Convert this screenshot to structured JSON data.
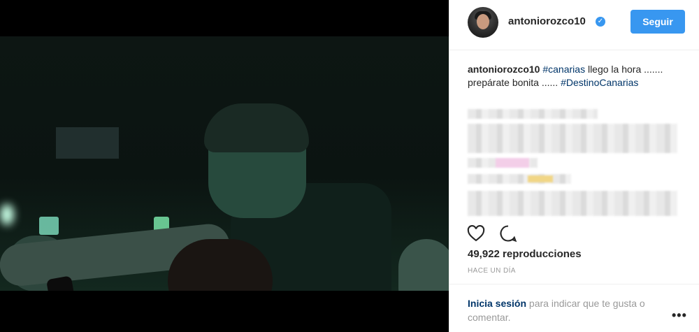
{
  "post": {
    "username": "antoniorozco10",
    "verified_icon": "verified-badge-icon",
    "follow_label": "Seguir",
    "caption": {
      "user": "antoniorozco10",
      "tag1": "#canarias",
      "text": " llego la hora ....... prepárate bonita ...... ",
      "tag2": "#DestinoCanarias"
    },
    "views": "49,922 reproducciones",
    "time": "HACE UN DÍA",
    "login_link": "Inicia sesión",
    "login_rest": " para indicar que te gusta o comentar.",
    "more_label": "•••"
  },
  "colors": {
    "accent": "#3897f0",
    "link": "#003569",
    "text": "#262626",
    "muted": "#999999"
  }
}
